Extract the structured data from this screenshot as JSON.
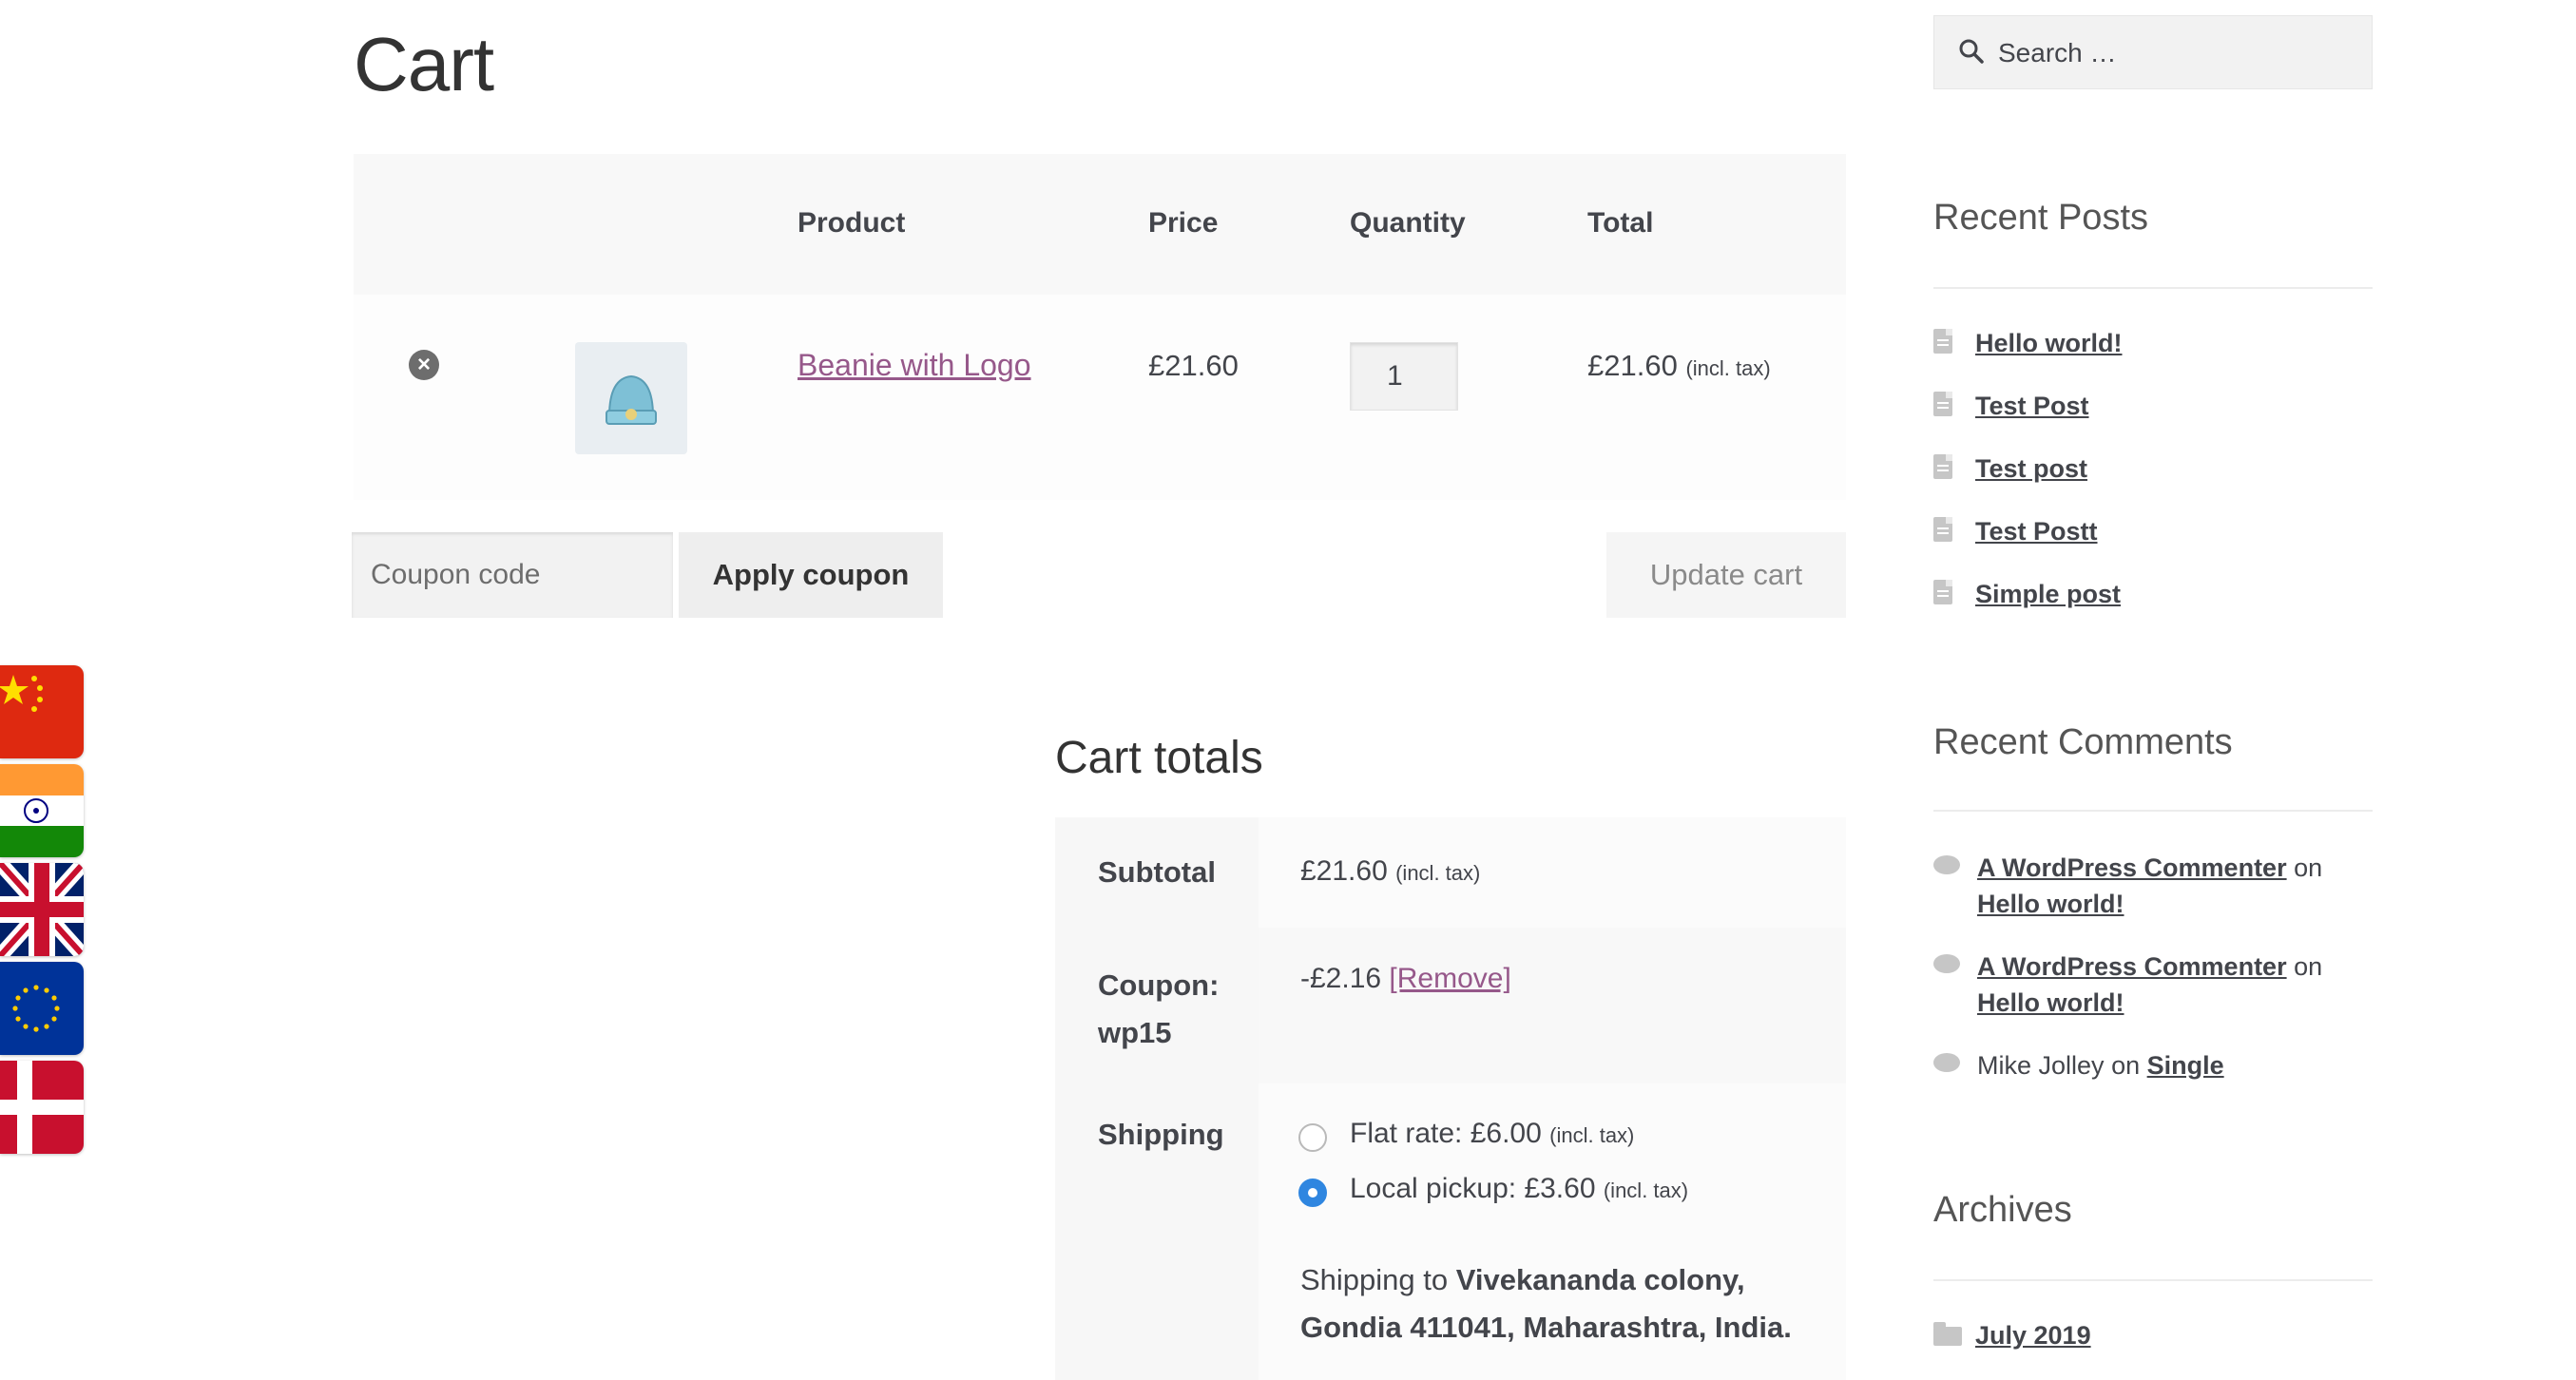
{
  "page": {
    "title": "Cart"
  },
  "cart": {
    "headers": {
      "product": "Product",
      "price": "Price",
      "quantity": "Quantity",
      "total": "Total"
    },
    "items": [
      {
        "remove_label": "×",
        "name": "Beanie with Logo",
        "price": "£21.60",
        "quantity": "1",
        "total": "£21.60",
        "total_note": "(incl. tax)"
      }
    ],
    "coupon_placeholder": "Coupon code",
    "apply_label": "Apply coupon",
    "update_label": "Update cart"
  },
  "totals": {
    "title": "Cart totals",
    "subtotal_label": "Subtotal",
    "subtotal_value": "£21.60",
    "subtotal_note": "(incl. tax)",
    "coupon_label_1": "Coupon:",
    "coupon_label_2": "wp15",
    "coupon_value": "-£2.16",
    "coupon_remove": "[Remove]",
    "shipping_label": "Shipping",
    "shipping_options": [
      {
        "label": "Flat rate: £6.00",
        "note": "(incl. tax)",
        "checked": false
      },
      {
        "label": "Local pickup: £3.60",
        "note": "(incl. tax)",
        "checked": true
      }
    ],
    "ship_to_prefix": "Shipping to",
    "ship_to_address": "Vivekananda colony, Gondia 411041, Maharashtra, India."
  },
  "sidebar": {
    "search_placeholder": "Search …",
    "recent_posts_title": "Recent Posts",
    "recent_posts": [
      "Hello world!",
      "Test Post",
      "Test post",
      "Test Postt",
      "Simple post"
    ],
    "recent_comments_title": "Recent Comments",
    "comments": [
      {
        "author": "A WordPress Commenter",
        "on": "on",
        "post": "Hello world!"
      },
      {
        "author": "A WordPress Commenter",
        "on": "on",
        "post": "Hello world!"
      },
      {
        "author": "Mike Jolley",
        "on": "on",
        "post": "Single"
      }
    ],
    "archives_title": "Archives",
    "archives": [
      "July 2019"
    ]
  },
  "flags": [
    "china-flag-icon",
    "india-flag-icon",
    "uk-flag-icon",
    "eu-flag-icon",
    "denmark-flag-icon"
  ],
  "colors": {
    "link": "#96588a",
    "radio_checked": "#2f86e0"
  }
}
